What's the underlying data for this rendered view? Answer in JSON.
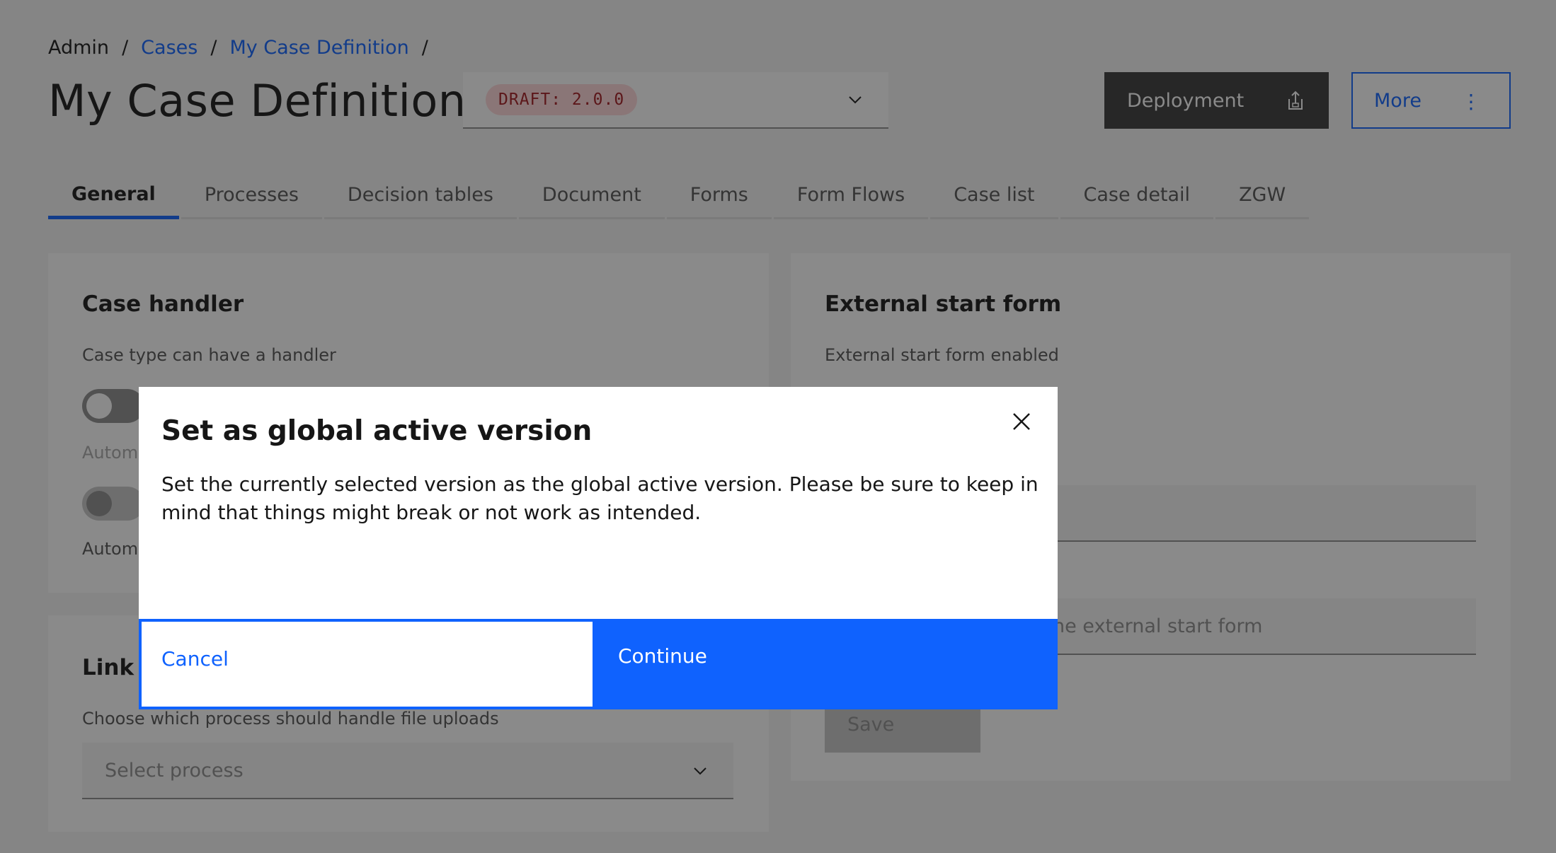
{
  "breadcrumb": {
    "items": [
      {
        "label": "Admin"
      },
      {
        "label": "Cases"
      },
      {
        "label": "My Case Definition"
      }
    ],
    "separator": "/"
  },
  "header": {
    "title": "My Case Definition",
    "version_badge": "DRAFT: 2.0.0",
    "deployment_label": "Deployment",
    "more_label": "More"
  },
  "tabs": [
    {
      "label": "General"
    },
    {
      "label": "Processes"
    },
    {
      "label": "Decision tables"
    },
    {
      "label": "Document"
    },
    {
      "label": "Forms"
    },
    {
      "label": "Form Flows"
    },
    {
      "label": "Case list"
    },
    {
      "label": "Case detail"
    },
    {
      "label": "ZGW"
    }
  ],
  "case_handler": {
    "title": "Case handler",
    "toggle_label": "Case type can have a handler",
    "auto_label_1": "Automa",
    "auto_label_2": "Automa"
  },
  "link_uploads": {
    "title": "Link u",
    "description": "Choose which process should handle file uploads",
    "select_placeholder": "Select process"
  },
  "external_start_form": {
    "title": "External start form",
    "toggle_label": "External start form enabled",
    "field_2_placeholder": "he external start form",
    "save_label": "Save"
  },
  "modal": {
    "title": "Set as global active version",
    "body": "Set the currently selected version as the global active version. Please be sure to keep in mind that things might break or not work as intended.",
    "cancel_label": "Cancel",
    "continue_label": "Continue"
  },
  "colors": {
    "accent": "#0f62fe",
    "badge_bg": "#ffd7d9",
    "badge_text": "#a2191f"
  }
}
